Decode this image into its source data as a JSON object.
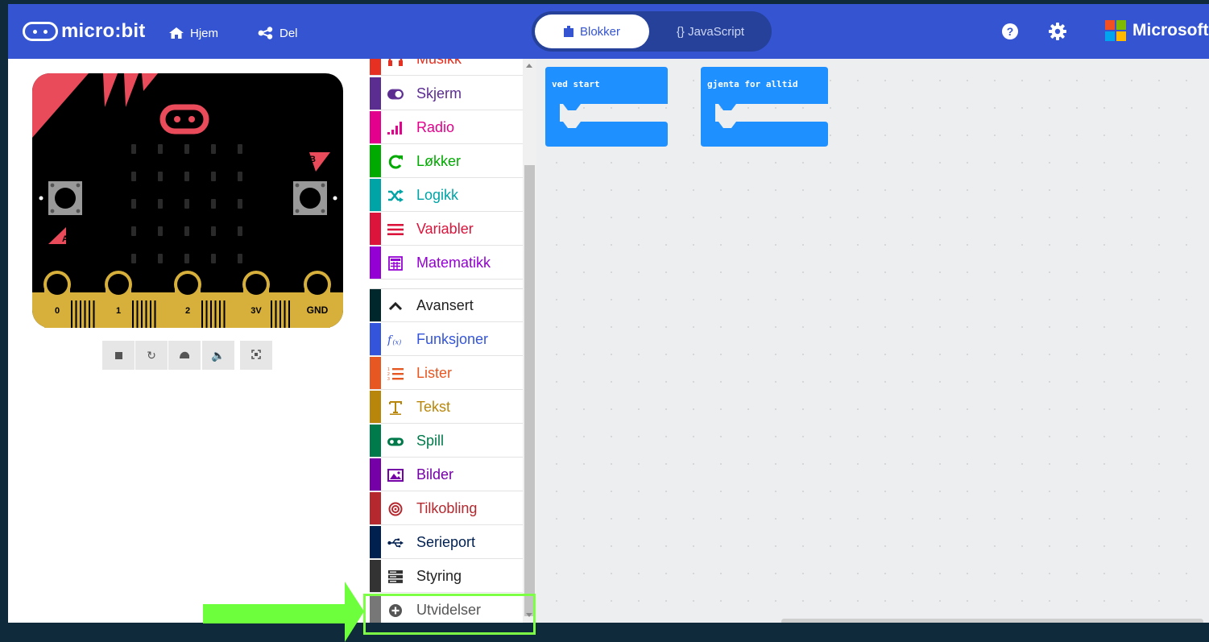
{
  "header": {
    "logo_text": "micro:bit",
    "home_label": "Hjem",
    "share_label": "Del",
    "tab_blocks": "Blokker",
    "tab_javascript": "{} JavaScript",
    "brand_text": "Microsoft"
  },
  "simulator": {
    "pins": [
      "0",
      "1",
      "2",
      "3V",
      "GND"
    ],
    "button_a": "A",
    "button_b": "B",
    "controls": [
      "stop-icon",
      "restart-icon",
      "slow-motion-icon",
      "mute-icon",
      "fullscreen-icon"
    ]
  },
  "toolbox": {
    "categories": [
      {
        "label": "Musikk",
        "color": "#e63022",
        "icon": "headphones-icon"
      },
      {
        "label": "Skjerm",
        "color": "#5c2d91",
        "icon": "toggle-icon"
      },
      {
        "label": "Radio",
        "color": "#e3008c",
        "icon": "signal-icon"
      },
      {
        "label": "Løkker",
        "color": "#00aa00",
        "icon": "loop-icon"
      },
      {
        "label": "Logikk",
        "color": "#00a4a6",
        "icon": "shuffle-icon"
      },
      {
        "label": "Variabler",
        "color": "#dc143c",
        "icon": "list-lines-icon"
      },
      {
        "label": "Matematikk",
        "color": "#9400d3",
        "icon": "calculator-icon"
      },
      {
        "label": "Avansert",
        "color": "#00272b",
        "icon": "chevron-up-icon"
      },
      {
        "label": "Funksjoner",
        "color": "#3455db",
        "icon": "function-icon"
      },
      {
        "label": "Lister",
        "color": "#e65722",
        "icon": "numbered-list-icon"
      },
      {
        "label": "Tekst",
        "color": "#b8860b",
        "icon": "text-icon"
      },
      {
        "label": "Spill",
        "color": "#007a4b",
        "icon": "gamepad-icon"
      },
      {
        "label": "Bilder",
        "color": "#7600a8",
        "icon": "image-icon"
      },
      {
        "label": "Tilkobling",
        "color": "#b4282e",
        "icon": "target-icon"
      },
      {
        "label": "Serieport",
        "color": "#002050",
        "icon": "usb-icon"
      },
      {
        "label": "Styring",
        "color": "#333333",
        "icon": "server-icon"
      },
      {
        "label": "Utvidelser",
        "color": "#777777",
        "icon": "plus-circle-icon"
      }
    ]
  },
  "workspace": {
    "blocks": [
      {
        "label": "ved start",
        "color": "#1e90ff"
      },
      {
        "label": "gjenta for alltid",
        "color": "#1e90ff"
      }
    ]
  },
  "colors": {
    "header_bg": "#3454d1",
    "frame_bg": "#0e2a3b",
    "annotation_green": "#7dff45"
  }
}
